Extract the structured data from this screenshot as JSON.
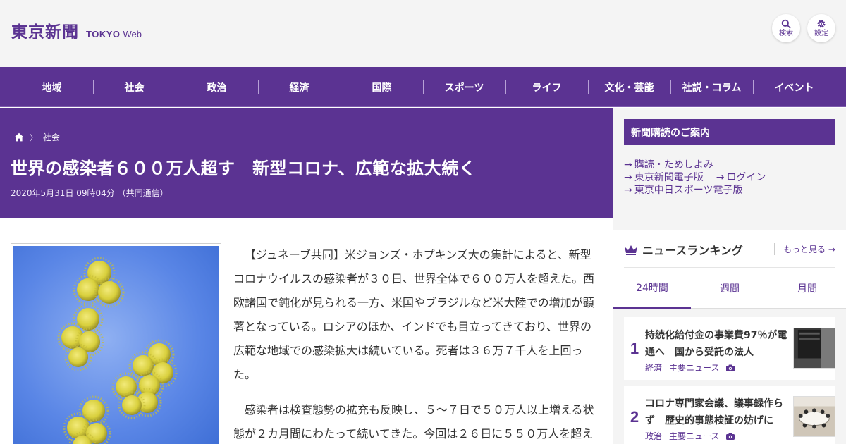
{
  "header": {
    "logo_jp": "東京新聞",
    "logo_tokyo": "TOKYO",
    "logo_web": "Web",
    "search_label": "検索",
    "settings_label": "設定"
  },
  "nav": {
    "items": [
      "地域",
      "社会",
      "政治",
      "経済",
      "国際",
      "スポーツ",
      "ライフ",
      "文化・芸能",
      "社説・コラム",
      "イベント"
    ]
  },
  "breadcrumb": {
    "separator": "〉",
    "category": "社会"
  },
  "article": {
    "headline": "世界の感染者６００万人超す　新型コロナ、広範な拡大続く",
    "dateline": "2020年5月31日 09時04分 （共同通信）",
    "paragraphs": [
      "【ジュネーブ共同】米ジョンズ・ホプキンズ大の集計によると、新型コロナウイルスの感染者が３０日、世界全体で６００万人を超えた。西欧諸国で鈍化が見られる一方、米国やブラジルなど米大陸での増加が顕著となっている。ロシアのほか、インドでも目立ってきており、世界の広範な地域での感染拡大は続いている。死者は３６万７千人を上回った。",
      "感染者は検査態勢の拡充も反映し、５～７日で５０万人以上増える状態が２カ月間にわたって続いてきた。今回は２６日に５５０万人を超え"
    ]
  },
  "subscription": {
    "title": "新聞購読のご案内",
    "arrow": "→",
    "links": [
      [
        "購読・ためしよみ"
      ],
      [
        "東京新聞電子版",
        "ログイン"
      ],
      [
        "東京中日スポーツ電子版"
      ]
    ]
  },
  "ranking": {
    "title": "ニュースランキング",
    "more_label": "もっと見る",
    "more_arrow": "→",
    "tabs": [
      "24時間",
      "週間",
      "月間"
    ],
    "active_tab": "24時間",
    "items": [
      {
        "rank": "1",
        "headline": "持続化給付金の事業費97％が電通へ　国から受託の法人",
        "tags": [
          "経済",
          "主要ニュース"
        ]
      },
      {
        "rank": "2",
        "headline": "コロナ専門家会議、議事録作らず　歴史的事態検証の妨げに",
        "tags": [
          "政治",
          "主要ニュース"
        ]
      }
    ]
  },
  "colors": {
    "brand_purple": "#5b3392",
    "virus_yellow": "#d8cf3c",
    "photo_blue": "#3f6fd6"
  }
}
